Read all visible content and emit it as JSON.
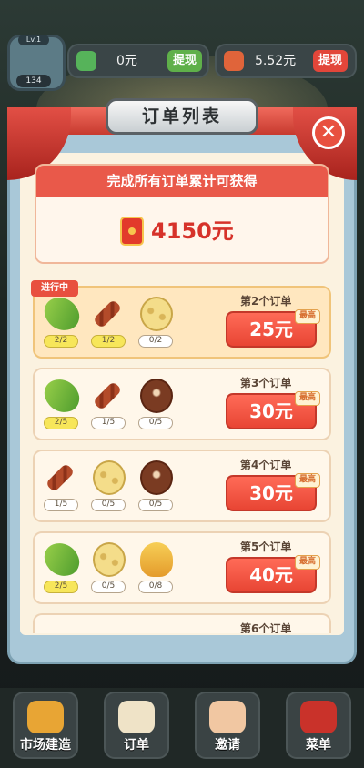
{
  "top_bar": {
    "level": "Lv.1",
    "avatar_count": "134",
    "cash_value": "0元",
    "cash_withdraw": "提现",
    "redpack_value": "5.52元",
    "redpack_withdraw": "提现"
  },
  "panel": {
    "title": "订单列表",
    "close_icon": "✕",
    "reward_heading": "完成所有订单累计可获得",
    "reward_amount": "4150元"
  },
  "orders": [
    {
      "tag": "进行中",
      "title": "第2个订单",
      "reward": "25元",
      "badge": "最高",
      "items": [
        {
          "food": "pepper",
          "progress": "2/2",
          "done": true
        },
        {
          "food": "meat",
          "progress": "1/2",
          "done": true
        },
        {
          "food": "lotus",
          "progress": "0/2",
          "done": false
        }
      ]
    },
    {
      "title": "第3个订单",
      "reward": "30元",
      "badge": "最高",
      "items": [
        {
          "food": "pepper",
          "progress": "2/5",
          "done": true
        },
        {
          "food": "meat",
          "progress": "1/5",
          "done": false
        },
        {
          "food": "mushroom",
          "progress": "0/5",
          "done": false
        }
      ]
    },
    {
      "title": "第4个订单",
      "reward": "30元",
      "badge": "最高",
      "items": [
        {
          "food": "meat",
          "progress": "1/5",
          "done": false
        },
        {
          "food": "lotus",
          "progress": "0/5",
          "done": false
        },
        {
          "food": "mushroom",
          "progress": "0/5",
          "done": false
        }
      ]
    },
    {
      "title": "第5个订单",
      "reward": "40元",
      "badge": "最高",
      "items": [
        {
          "food": "pepper",
          "progress": "2/5",
          "done": true
        },
        {
          "food": "lotus",
          "progress": "0/5",
          "done": false
        },
        {
          "food": "corn",
          "progress": "0/8",
          "done": false
        }
      ]
    },
    {
      "title": "第6个订单"
    }
  ],
  "bottom_nav": {
    "market": "市场建造",
    "orders": "订单",
    "invite": "邀请",
    "menu": "菜单"
  },
  "colors": {
    "accent_red": "#e8503f",
    "progress_done": "#f7e65a",
    "panel_bg": "#fbf2e0"
  }
}
